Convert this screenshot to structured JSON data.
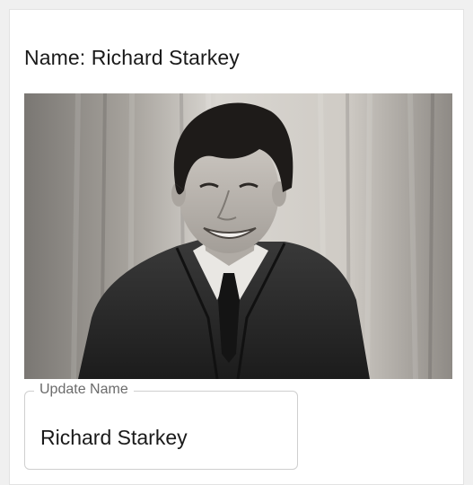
{
  "profile": {
    "name_prefix": "Name: ",
    "name": "Richard Starkey"
  },
  "photo": {
    "alt": "Black and white portrait photo"
  },
  "update_field": {
    "label": "Update Name",
    "value": "Richard Starkey"
  },
  "colors": {
    "page_background": "#f0f0f0",
    "card_background": "#ffffff",
    "text": "#1a1a1a",
    "field_border": "#cfcfcf",
    "label_text": "#6b6b6b"
  }
}
